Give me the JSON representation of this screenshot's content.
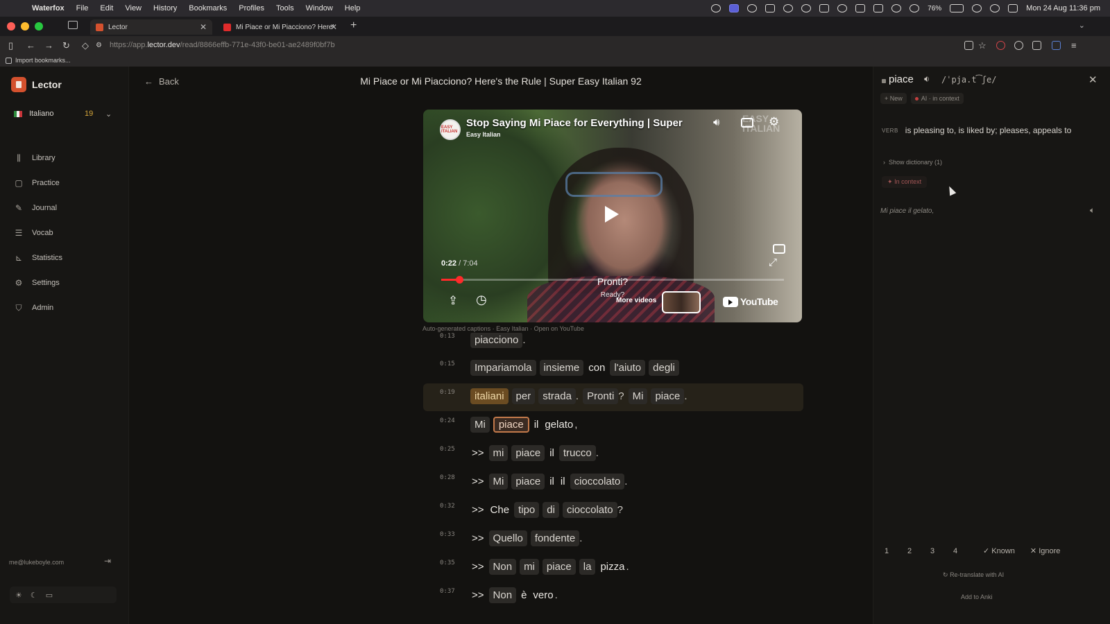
{
  "menubar": {
    "app": "Waterfox",
    "items": [
      "File",
      "Edit",
      "View",
      "History",
      "Bookmarks",
      "Profiles",
      "Tools",
      "Window",
      "Help"
    ],
    "battery": "76%",
    "datetime": "Mon 24 Aug  11:36 pm"
  },
  "browser": {
    "tabs": [
      {
        "title": "Lector",
        "active": true
      },
      {
        "title": "Mi Piace or Mi Piacciono? Here'",
        "active": false
      }
    ],
    "url_prefix": "https://app.",
    "url_domain": "lector.dev",
    "url_path": "/read/8866effb-771e-43f0-be01-ae2489f0bf7b",
    "bookmark": "Import bookmarks..."
  },
  "sidebar": {
    "brand": "Lector",
    "language": "Italiano",
    "language_count": "19",
    "nav": [
      {
        "label": "Library",
        "icon": "library-icon"
      },
      {
        "label": "Practice",
        "icon": "practice-icon"
      },
      {
        "label": "Journal",
        "icon": "pencil-icon"
      },
      {
        "label": "Vocab",
        "icon": "list-icon"
      },
      {
        "label": "Statistics",
        "icon": "chart-icon"
      },
      {
        "label": "Settings",
        "icon": "gear-icon"
      },
      {
        "label": "Admin",
        "icon": "shield-icon"
      }
    ],
    "user_email": "me@lukeboyle.com"
  },
  "main": {
    "back_label": "Back",
    "page_title": "Mi Piace or Mi Piacciono? Here's the Rule | Super Easy Italian 92",
    "video": {
      "title": "Stop Saying Mi Piace for Everything | Super",
      "channel": "Easy Italian",
      "logo_text": "EASY ITALIAN",
      "watermark": "EASY ITALIAN",
      "current_time": "0:22",
      "duration": "7:04",
      "progress": 0.052,
      "subtitle": "Pronti?",
      "subtitle_translation": "Ready?",
      "more_videos": "More videos",
      "youtube_label": "YouTube"
    },
    "caption_meta": "Auto-generated captions · Easy Italian · Open on YouTube",
    "transcript": [
      {
        "time": "0:13",
        "tokens": [
          {
            "t": "piacciono",
            "k": "chip"
          },
          {
            "t": ".",
            "k": "punct"
          }
        ]
      },
      {
        "time": "0:15",
        "tokens": [
          {
            "t": "Impariamola",
            "k": "chip"
          },
          {
            "t": "insieme",
            "k": "chip"
          },
          {
            "t": "con",
            "k": "plain"
          },
          {
            "t": "l'aiuto",
            "k": "chip"
          },
          {
            "t": "degli",
            "k": "chip"
          }
        ]
      },
      {
        "time": "0:19",
        "current": true,
        "tokens": [
          {
            "t": "italiani",
            "k": "hl"
          },
          {
            "t": "per",
            "k": "chip"
          },
          {
            "t": "strada",
            "k": "chip"
          },
          {
            "t": ".",
            "k": "punct"
          },
          {
            "t": "Pronti",
            "k": "chip"
          },
          {
            "t": "?",
            "k": "punct"
          },
          {
            "t": "Mi",
            "k": "chip"
          },
          {
            "t": "piace",
            "k": "chip"
          },
          {
            "t": ".",
            "k": "punct"
          }
        ]
      },
      {
        "time": "0:24",
        "tokens": [
          {
            "t": "Mi",
            "k": "chip"
          },
          {
            "t": "piace",
            "k": "sel"
          },
          {
            "t": "il",
            "k": "plain"
          },
          {
            "t": "gelato",
            "k": "plain"
          },
          {
            "t": ",",
            "k": "punct"
          }
        ]
      },
      {
        "time": "0:25",
        "tokens": [
          {
            "t": ">>",
            "k": "plain"
          },
          {
            "t": "mi",
            "k": "chip"
          },
          {
            "t": "piace",
            "k": "chip"
          },
          {
            "t": "il",
            "k": "plain"
          },
          {
            "t": "trucco",
            "k": "chip"
          },
          {
            "t": ".",
            "k": "punct"
          }
        ]
      },
      {
        "time": "0:28",
        "tokens": [
          {
            "t": ">>",
            "k": "plain"
          },
          {
            "t": "Mi",
            "k": "chip"
          },
          {
            "t": "piace",
            "k": "chip"
          },
          {
            "t": "il",
            "k": "plain"
          },
          {
            "t": "il",
            "k": "plain"
          },
          {
            "t": "cioccolato",
            "k": "chip"
          },
          {
            "t": ".",
            "k": "punct"
          }
        ]
      },
      {
        "time": "0:32",
        "tokens": [
          {
            "t": ">>",
            "k": "plain"
          },
          {
            "t": "Che",
            "k": "plain"
          },
          {
            "t": "tipo",
            "k": "chip"
          },
          {
            "t": "di",
            "k": "chip"
          },
          {
            "t": "cioccolato",
            "k": "chip"
          },
          {
            "t": "?",
            "k": "punct"
          }
        ]
      },
      {
        "time": "0:33",
        "tokens": [
          {
            "t": ">>",
            "k": "plain"
          },
          {
            "t": "Quello",
            "k": "chip"
          },
          {
            "t": "fondente",
            "k": "chip"
          },
          {
            "t": ".",
            "k": "punct"
          }
        ]
      },
      {
        "time": "0:35",
        "tokens": [
          {
            "t": ">>",
            "k": "plain"
          },
          {
            "t": "Non",
            "k": "chip"
          },
          {
            "t": "mi",
            "k": "chip"
          },
          {
            "t": "piace",
            "k": "chip"
          },
          {
            "t": "la",
            "k": "chip"
          },
          {
            "t": "pizza",
            "k": "plain"
          },
          {
            "t": ".",
            "k": "punct"
          }
        ]
      },
      {
        "time": "0:37",
        "tokens": [
          {
            "t": ">>",
            "k": "plain"
          },
          {
            "t": "Non",
            "k": "chip"
          },
          {
            "t": "è",
            "k": "plain"
          },
          {
            "t": "vero",
            "k": "plain"
          },
          {
            "t": ".",
            "k": "punct"
          }
        ]
      }
    ]
  },
  "panel": {
    "word": "piace",
    "ipa": "/ˈpja.t͡ʃe/",
    "badge_new": "New",
    "badge_ai": "AI · in context",
    "pos": "VERB",
    "definition": "is pleasing to, is liked by; pleases, appeals to",
    "show_dictionary": "Show dictionary (1)",
    "in_context": "In context",
    "example": "Mi piace il gelato,",
    "ratings": [
      "1",
      "2",
      "3",
      "4"
    ],
    "known": "Known",
    "ignore": "Ignore",
    "retranslate": "Re-translate with AI",
    "add_to_anki": "Add to Anki"
  },
  "colors": {
    "accent": "#d4512e",
    "highlight_word": "#6b4c22",
    "selected_border": "#c47a4b",
    "count_badge": "#d8a83b"
  }
}
